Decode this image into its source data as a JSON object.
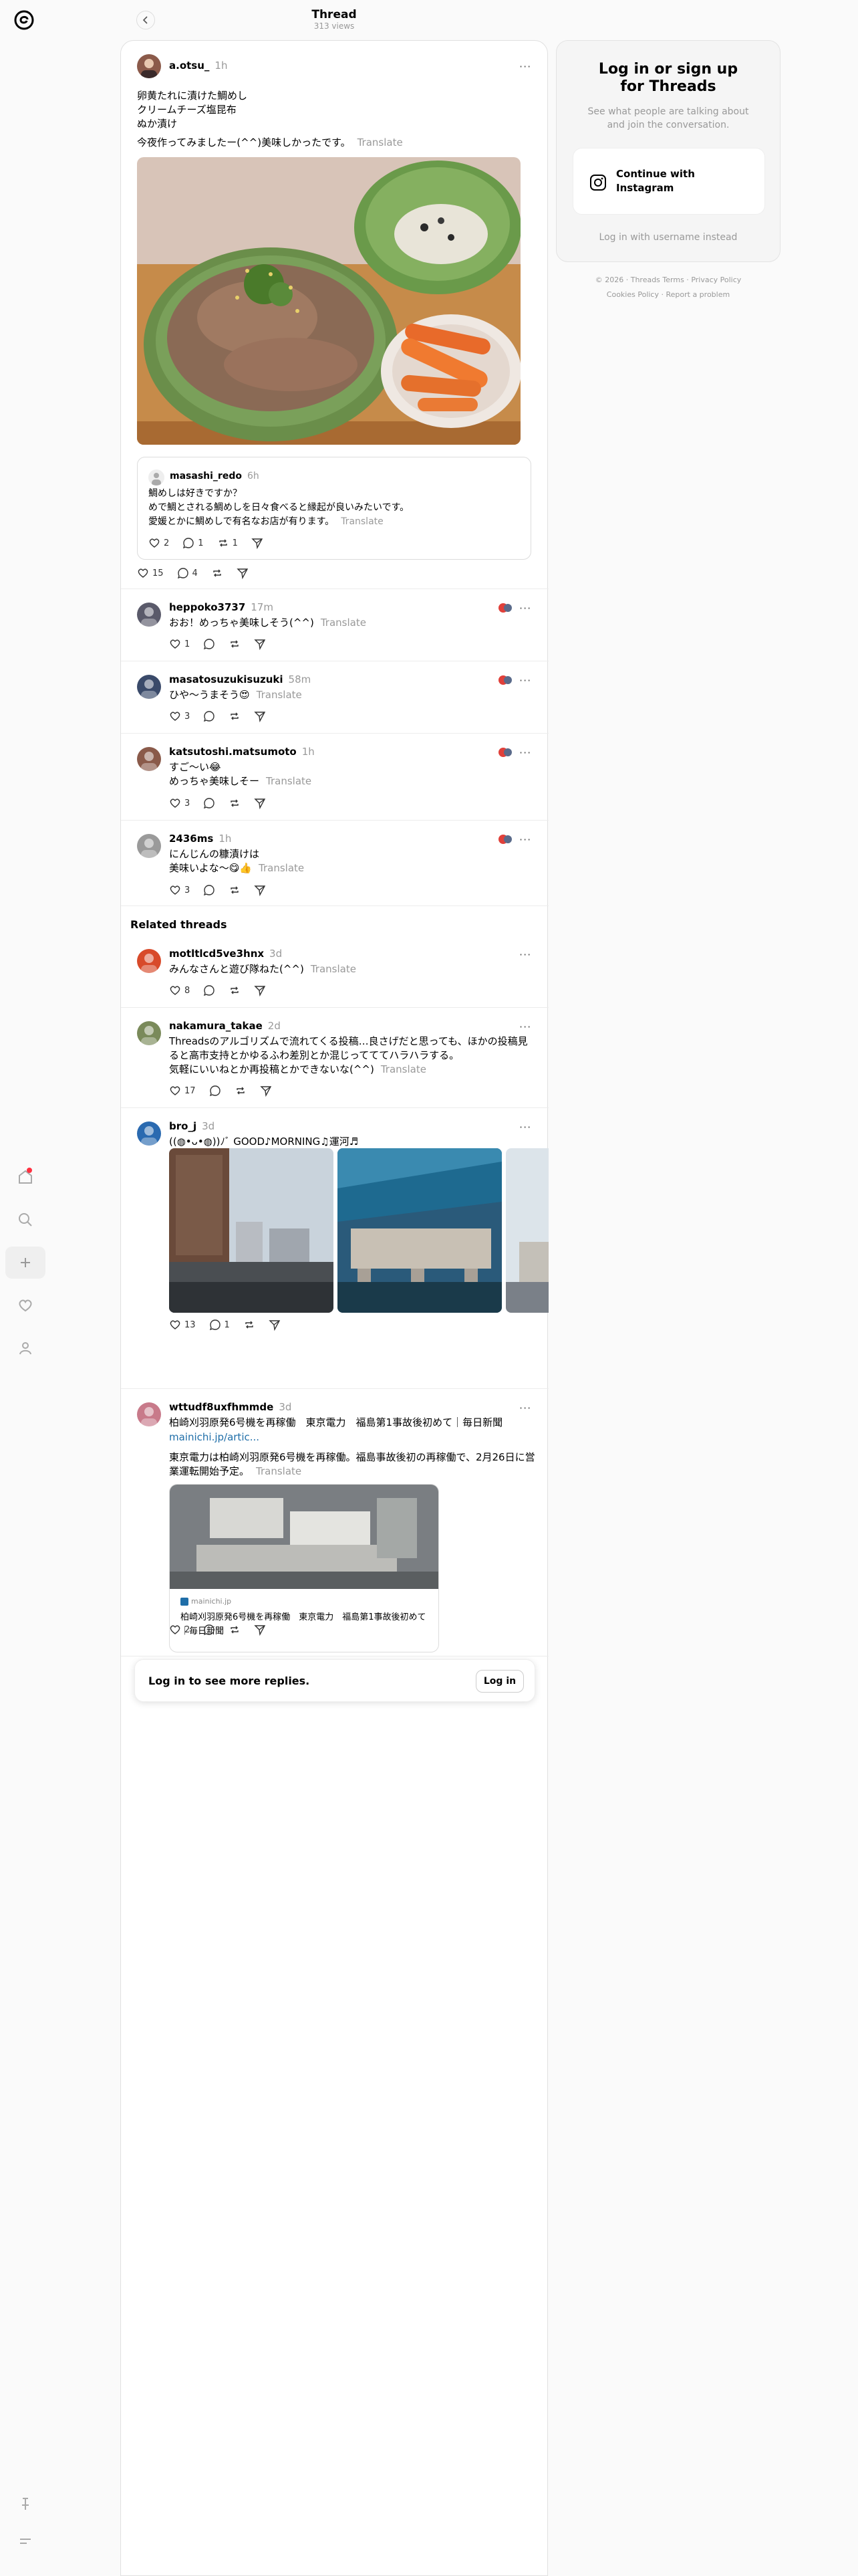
{
  "header": {
    "title": "Thread",
    "views": "313 views"
  },
  "sidebar_login": {
    "title": "Log in or sign up for Threads",
    "subtitle": "See what people are talking about and join the conversation.",
    "instagram_button": "Continue with Instagram",
    "username_link": "Log in with username instead"
  },
  "footer": {
    "year": "© 2026",
    "terms": "Threads Terms",
    "privacy": "Privacy Policy",
    "cookies": "Cookies Policy",
    "report": "Report a problem"
  },
  "main_post": {
    "username": "a.otsu_",
    "time": "1h",
    "text": "卵黄たれに漬けた鯛めし\nクリームチーズ塩昆布\nぬか漬け",
    "text2": "今夜作ってみましたー(^^)美味しかったです。",
    "translate": "Translate",
    "likes": "15",
    "replies": "4",
    "quote": {
      "username": "masashi_redo",
      "time": "6h",
      "text": "鯛めしは好きですか？\nめで鯛とされる鯛めしを日々食べると縁起が良いみたいです。\n愛媛とかに鯛めしで有名なお店が有ります。",
      "translate": "Translate",
      "likes": "2",
      "replies": "1",
      "reposts": "1"
    }
  },
  "replies": [
    {
      "username": "heppoko3737",
      "time": "17m",
      "text": "おお！めっちゃ美味しそう(^^)",
      "translate": "Translate",
      "likes": "1"
    },
    {
      "username": "masatosuzukisuzuki",
      "time": "58m",
      "text": "ひや〜うまそう😍",
      "translate": "Translate",
      "likes": "3"
    },
    {
      "username": "katsutoshi.matsumoto",
      "time": "1h",
      "text": "すご〜い😂\nめっちゃ美味しそー",
      "translate": "Translate",
      "likes": "3"
    },
    {
      "username": "2436ms",
      "time": "1h",
      "text": "にんじんの糠漬けは\n美味いよな〜😋👍",
      "translate": "Translate",
      "likes": "3"
    }
  ],
  "related_title": "Related threads",
  "related": [
    {
      "username": "motltlcd5ve3hnx",
      "time": "3d",
      "text": "みんなさんと遊び隊ねた(^^)",
      "translate": "Translate",
      "likes": "8"
    },
    {
      "username": "nakamura_takae",
      "time": "2d",
      "text": "Threadsのアルゴリズムで流れてくる投稿…良さげだと思っても、ほかの投稿見ると高市支持とかゆるふわ差別とか混じってててハラハラする。\n気軽にいいねとか再投稿とかできないな(^^)",
      "translate": "Translate",
      "likes": "17"
    },
    {
      "username": "bro_j",
      "time": "3d",
      "text": "((◍•ᴗ•◍))ﾉﾞ GOOD♪MORNING♫運河♬",
      "likes": "13",
      "replies": "1"
    },
    {
      "username": "wttudf8uxfhmmde",
      "time": "3d",
      "text": "柏崎刈羽原発6号機を再稼働　東京電力　福島第1事故後初めて｜毎日新聞",
      "link": "mainichi.jp/artic...",
      "text2": "東京電力は柏崎刈羽原発6号機を再稼働。福島事故後初の再稼働で、2月26日に営業運転開始予定。",
      "translate": "Translate",
      "likes": "2",
      "card": {
        "domain": "mainichi.jp",
        "title": "柏崎刈羽原発6号機を再稼働　東京電力　福島第1事故後初めて｜毎日新聞"
      }
    }
  ],
  "login_bar": {
    "text": "Log in to see more replies.",
    "button": "Log in"
  }
}
